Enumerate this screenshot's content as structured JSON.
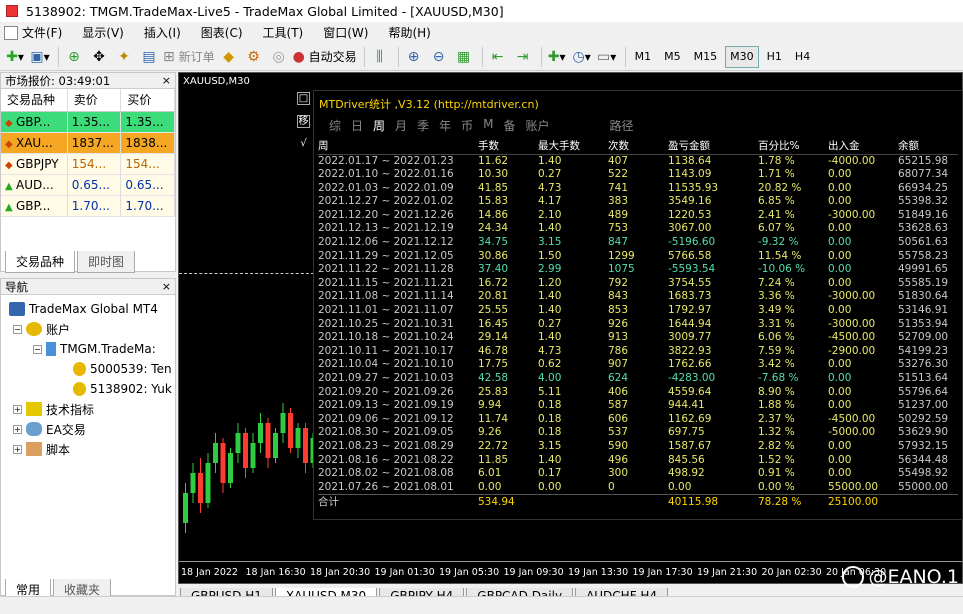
{
  "window": {
    "title": "5138902: TMGM.TradeMax-Live5 - TradeMax Global Limited - [XAUUSD,M30]"
  },
  "menu": [
    {
      "label": "文件(F)"
    },
    {
      "label": "显示(V)"
    },
    {
      "label": "插入(I)"
    },
    {
      "label": "图表(C)"
    },
    {
      "label": "工具(T)"
    },
    {
      "label": "窗口(W)"
    },
    {
      "label": "帮助(H)"
    }
  ],
  "toolbar": {
    "new_order": "新订单",
    "auto_trading": "自动交易",
    "timeframes": [
      "M1",
      "M5",
      "M15",
      "M30",
      "H1",
      "H4"
    ],
    "active_timeframe": "M30"
  },
  "market_watch": {
    "header": "市场报价: 03:49:01",
    "columns": [
      "交易品种",
      "卖价",
      "买价"
    ],
    "rows": [
      {
        "symbol": "GBP...",
        "bid": "1.35...",
        "ask": "1.35...",
        "dir": "down"
      },
      {
        "symbol": "XAU...",
        "bid": "1837...",
        "ask": "1838...",
        "dir": "down"
      },
      {
        "symbol": "GBPJPY",
        "bid": "154...",
        "ask": "154...",
        "dir": "down"
      },
      {
        "symbol": "AUD...",
        "bid": "0.65...",
        "ask": "0.65...",
        "dir": "up"
      },
      {
        "symbol": "GBP...",
        "bid": "1.70...",
        "ask": "1.70...",
        "dir": "up"
      }
    ],
    "tabs": [
      "交易品种",
      "即时图"
    ]
  },
  "navigator": {
    "header": "导航",
    "root": "TradeMax Global MT4",
    "accounts_label": "账户",
    "server": "TMGM.TradeMa:",
    "accounts": [
      "5000539: Ten",
      "5138902: Yuk"
    ],
    "indicators": "技术指标",
    "experts": "EA交易",
    "scripts": "脚本",
    "tabs": [
      "常用",
      "收藏夹"
    ]
  },
  "chart": {
    "symbol_label": "XAUUSD,M30",
    "x_labels": [
      "18 Jan 2022",
      "18 Jan 16:30",
      "18 Jan 20:30",
      "19 Jan 01:30",
      "19 Jan 05:30",
      "19 Jan 09:30",
      "19 Jan 13:30",
      "19 Jan 17:30",
      "19 Jan 21:30",
      "20 Jan 02:30",
      "20 Jan 06:30"
    ]
  },
  "mtdriver": {
    "title": "MTDriver统计 ,V3.12 (http://mtdriver.cn)",
    "side_buttons": [
      "□",
      "移",
      "√"
    ],
    "tabs": [
      "综",
      "日",
      "周",
      "月",
      "季",
      "年",
      "币",
      "M",
      "备",
      "账户",
      "路径"
    ],
    "active_tab": "周",
    "columns": [
      "周",
      "手数",
      "最大手数",
      "次数",
      "盈亏金额",
      "百分比%",
      "出入金",
      "余额"
    ],
    "rows": [
      [
        "2022.01.17 ~ 2022.01.23",
        "11.62",
        "1.40",
        "407",
        "1138.64",
        "1.78 %",
        "-4000.00",
        "65215.98"
      ],
      [
        "2022.01.10 ~ 2022.01.16",
        "10.30",
        "0.27",
        "522",
        "1143.09",
        "1.71 %",
        "0.00",
        "68077.34"
      ],
      [
        "2022.01.03 ~ 2022.01.09",
        "41.85",
        "4.73",
        "741",
        "11535.93",
        "20.82 %",
        "0.00",
        "66934.25"
      ],
      [
        "2021.12.27 ~ 2022.01.02",
        "15.83",
        "4.17",
        "383",
        "3549.16",
        "6.85 %",
        "0.00",
        "55398.32"
      ],
      [
        "2021.12.20 ~ 2021.12.26",
        "14.86",
        "2.10",
        "489",
        "1220.53",
        "2.41 %",
        "-3000.00",
        "51849.16"
      ],
      [
        "2021.12.13 ~ 2021.12.19",
        "24.34",
        "1.40",
        "753",
        "3067.00",
        "6.07 %",
        "0.00",
        "53628.63"
      ],
      [
        "2021.12.06 ~ 2021.12.12",
        "34.75",
        "3.15",
        "847",
        "-5196.60",
        "-9.32 %",
        "0.00",
        "50561.63"
      ],
      [
        "2021.11.29 ~ 2021.12.05",
        "30.86",
        "1.50",
        "1299",
        "5766.58",
        "11.54 %",
        "0.00",
        "55758.23"
      ],
      [
        "2021.11.22 ~ 2021.11.28",
        "37.40",
        "2.99",
        "1075",
        "-5593.54",
        "-10.06 %",
        "0.00",
        "49991.65"
      ],
      [
        "2021.11.15 ~ 2021.11.21",
        "16.72",
        "1.20",
        "792",
        "3754.55",
        "7.24 %",
        "0.00",
        "55585.19"
      ],
      [
        "2021.11.08 ~ 2021.11.14",
        "20.81",
        "1.40",
        "843",
        "1683.73",
        "3.36 %",
        "-3000.00",
        "51830.64"
      ],
      [
        "2021.11.01 ~ 2021.11.07",
        "25.55",
        "1.40",
        "853",
        "1792.97",
        "3.49 %",
        "0.00",
        "53146.91"
      ],
      [
        "2021.10.25 ~ 2021.10.31",
        "16.45",
        "0.27",
        "926",
        "1644.94",
        "3.31 %",
        "-3000.00",
        "51353.94"
      ],
      [
        "2021.10.18 ~ 2021.10.24",
        "29.14",
        "1.40",
        "913",
        "3009.77",
        "6.06 %",
        "-4500.00",
        "52709.00"
      ],
      [
        "2021.10.11 ~ 2021.10.17",
        "46.78",
        "4.73",
        "786",
        "3822.93",
        "7.59 %",
        "-2900.00",
        "54199.23"
      ],
      [
        "2021.10.04 ~ 2021.10.10",
        "17.75",
        "0.62",
        "907",
        "1762.66",
        "3.42 %",
        "0.00",
        "53276.30"
      ],
      [
        "2021.09.27 ~ 2021.10.03",
        "42.58",
        "4.00",
        "624",
        "-4283.00",
        "-7.68 %",
        "0.00",
        "51513.64"
      ],
      [
        "2021.09.20 ~ 2021.09.26",
        "25.83",
        "5.11",
        "406",
        "4559.64",
        "8.90 %",
        "0.00",
        "55796.64"
      ],
      [
        "2021.09.13 ~ 2021.09.19",
        "9.94",
        "0.18",
        "587",
        "944.41",
        "1.88 %",
        "0.00",
        "51237.00"
      ],
      [
        "2021.09.06 ~ 2021.09.12",
        "11.74",
        "0.18",
        "606",
        "1162.69",
        "2.37 %",
        "-4500.00",
        "50292.59"
      ],
      [
        "2021.08.30 ~ 2021.09.05",
        "9.26",
        "0.18",
        "537",
        "697.75",
        "1.32 %",
        "-5000.00",
        "53629.90"
      ],
      [
        "2021.08.23 ~ 2021.08.29",
        "22.72",
        "3.15",
        "590",
        "1587.67",
        "2.82 %",
        "0.00",
        "57932.15"
      ],
      [
        "2021.08.16 ~ 2021.08.22",
        "11.85",
        "1.40",
        "496",
        "845.56",
        "1.52 %",
        "0.00",
        "56344.48"
      ],
      [
        "2021.08.02 ~ 2021.08.08",
        "6.01",
        "0.17",
        "300",
        "498.92",
        "0.91 %",
        "0.00",
        "55498.92"
      ],
      [
        "2021.07.26 ~ 2021.08.01",
        "0.00",
        "0.00",
        "0",
        "0.00",
        "0.00 %",
        "55000.00",
        "55000.00"
      ]
    ],
    "total": [
      "合计",
      "534.94",
      "",
      "",
      "40115.98",
      "78.28 %",
      "25100.00",
      ""
    ],
    "colors": {
      "text": "#e8e86a",
      "loss": "#55ddb0",
      "header": "#ffffff",
      "total": "#ffd700"
    }
  },
  "symbol_tabs": [
    "GBPUSD,H1",
    "XAUUSD,M30",
    "GBPJPY,H4",
    "GBPCAD,Daily",
    "AUDCHF,H4"
  ],
  "active_symbol_tab": "XAUUSD,M30",
  "watermark": "@EANO.1"
}
